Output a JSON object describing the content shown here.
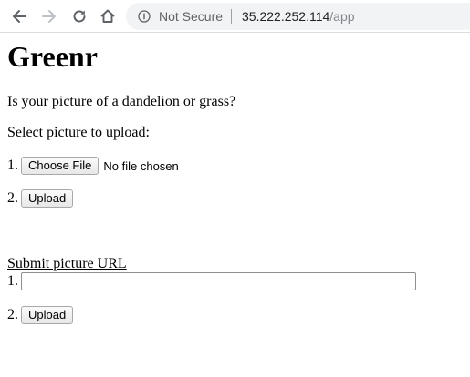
{
  "browser": {
    "back_icon": "arrow-left-icon",
    "forward_icon": "arrow-right-icon",
    "reload_icon": "reload-icon",
    "home_icon": "home-icon",
    "security_icon": "info-circle-icon",
    "security_label": "Not Secure",
    "url_host": "35.222.252.114",
    "url_path": "/app"
  },
  "page": {
    "title": "Greenr",
    "question": "Is your picture of a dandelion or grass?",
    "file_section": {
      "heading": "Select picture to upload:",
      "step1_number": "1.",
      "choose_file_label": "Choose File",
      "file_status": "No file chosen",
      "step2_number": "2.",
      "upload_label": "Upload"
    },
    "url_section": {
      "heading": "Submit picture URL",
      "step1_number": "1.",
      "url_value": "",
      "step2_number": "2.",
      "upload_label": "Upload"
    }
  },
  "colors": {
    "toolbar_bg": "#ffffff",
    "omnibox_bg": "#f1f3f4",
    "icon_gray": "#5f6368",
    "disabled_icon": "#bdc1c6",
    "url_path": "#80868b"
  }
}
